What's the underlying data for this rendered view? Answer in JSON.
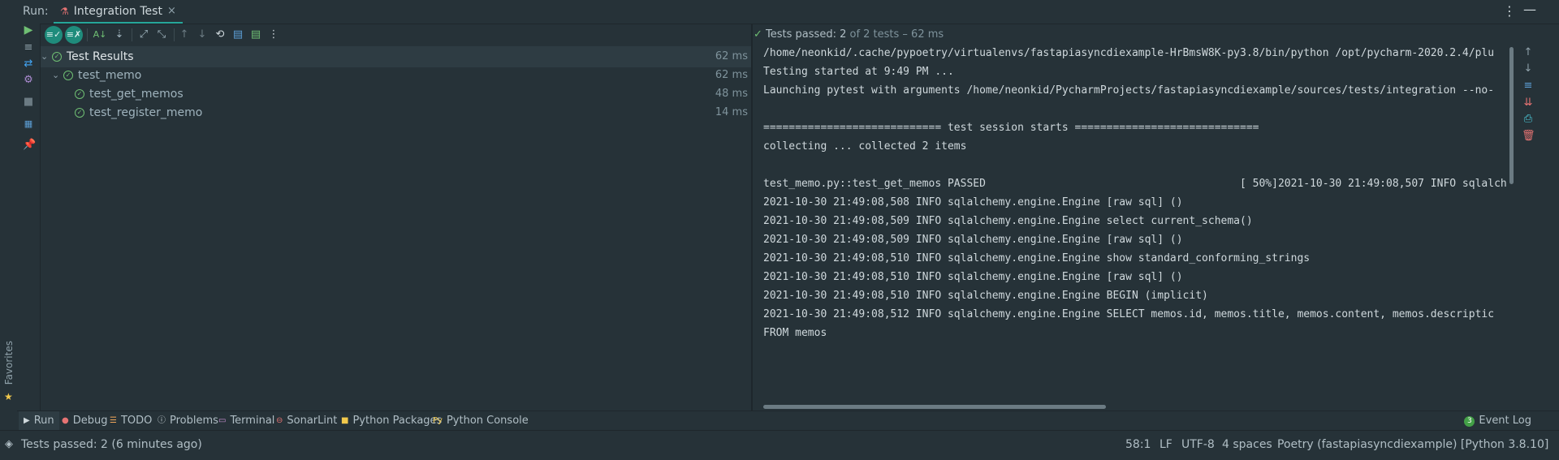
{
  "favorites": {
    "label": "Favorites"
  },
  "run_header": {
    "label": "Run:",
    "tab_title": "Integration Test",
    "close_glyph": "×",
    "menu_glyph": "⋮",
    "minimize_glyph": "—"
  },
  "toolbar": {
    "icons": [
      "rerun-icon",
      "rerun-failed-icon",
      "toggle-auto-test-icon",
      "sort-alpha-icon",
      "sort-duration-icon",
      "expand-all-icon",
      "collapse-all-icon",
      "previous-test-icon",
      "next-test-icon",
      "history-icon",
      "export-icon",
      "import-icon",
      "more-icon"
    ]
  },
  "tree": {
    "rows": [
      {
        "name": "Test Results",
        "duration": "62 ms"
      },
      {
        "name": "test_memo",
        "duration": "62 ms"
      },
      {
        "name": "test_get_memos",
        "duration": "48 ms"
      },
      {
        "name": "test_register_memo",
        "duration": "14 ms"
      }
    ]
  },
  "console_status": {
    "passed": "Tests passed: 2",
    "rest": " of 2 tests – 62 ms"
  },
  "console": {
    "lines": [
      "/home/neonkid/.cache/pypoetry/virtualenvs/fastapiasyncdiexample-HrBmsW8K-py3.8/bin/python /opt/pycharm-2020.2.4/plu",
      "Testing started at 9:49 PM ...",
      "Launching pytest with arguments /home/neonkid/PycharmProjects/fastapiasyncdiexample/sources/tests/integration --no-",
      "",
      "============================ test session starts =============================",
      "collecting ... collected 2 items",
      "",
      "test_memo.py::test_get_memos PASSED                                        [ 50%]2021-10-30 21:49:08,507 INFO sqlalch",
      "2021-10-30 21:49:08,508 INFO sqlalchemy.engine.Engine [raw sql] ()",
      "2021-10-30 21:49:08,509 INFO sqlalchemy.engine.Engine select current_schema()",
      "2021-10-30 21:49:08,509 INFO sqlalchemy.engine.Engine [raw sql] ()",
      "2021-10-30 21:49:08,510 INFO sqlalchemy.engine.Engine show standard_conforming_strings",
      "2021-10-30 21:49:08,510 INFO sqlalchemy.engine.Engine [raw sql] ()",
      "2021-10-30 21:49:08,510 INFO sqlalchemy.engine.Engine BEGIN (implicit)",
      "2021-10-30 21:49:08,512 INFO sqlalchemy.engine.Engine SELECT memos.id, memos.title, memos.content, memos.descriptic",
      "FROM memos"
    ]
  },
  "bottom_tabs": {
    "run": "Run",
    "debug": "Debug",
    "todo": "TODO",
    "problems": "Problems",
    "terminal": "Terminal",
    "sonarlint": "SonarLint",
    "python_packages": "Python Packages",
    "python_console": "Python Console",
    "event_log": "Event Log",
    "event_log_count": "3"
  },
  "status_bar": {
    "message": "Tests passed: 2 (6 minutes ago)",
    "position": "58:1",
    "line_sep": "LF",
    "encoding": "UTF-8",
    "indent": "4 spaces",
    "interpreter": "Poetry (fastapiasyncdiexample) [Python 3.8.10]"
  },
  "colors": {
    "background": "#263238",
    "accent": "#26a69a",
    "pass": "#6fbf73"
  }
}
